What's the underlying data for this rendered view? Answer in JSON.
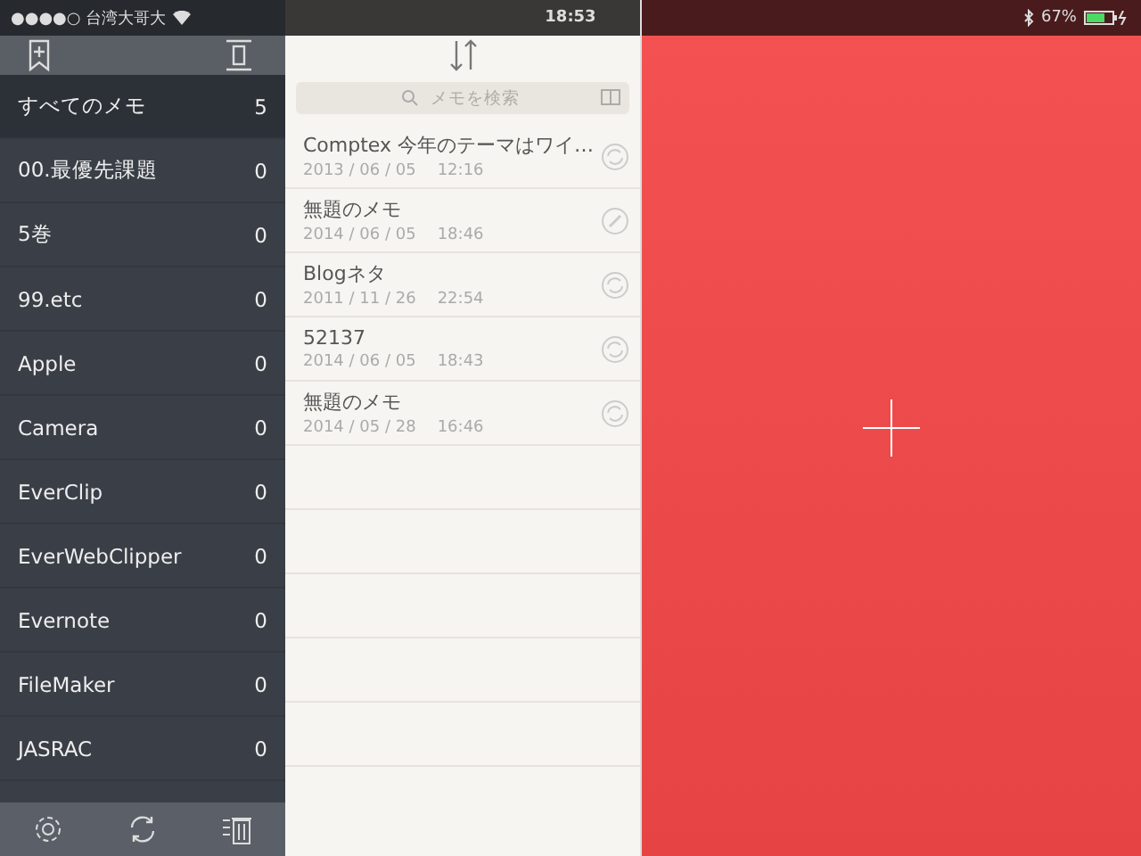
{
  "status_bar": {
    "carrier": "●●●●○ 台湾大哥大",
    "time": "18:53",
    "battery": "67%"
  },
  "sidebar": {
    "items": [
      {
        "label": "すべてのメモ",
        "count": "5",
        "selected": true
      },
      {
        "label": "00.最優先課題",
        "count": "0",
        "selected": false
      },
      {
        "label": "5巻",
        "count": "0",
        "selected": false
      },
      {
        "label": "99.etc",
        "count": "0",
        "selected": false
      },
      {
        "label": "Apple",
        "count": "0",
        "selected": false
      },
      {
        "label": "Camera",
        "count": "0",
        "selected": false
      },
      {
        "label": "EverClip",
        "count": "0",
        "selected": false
      },
      {
        "label": "EverWebClipper",
        "count": "0",
        "selected": false
      },
      {
        "label": "Evernote",
        "count": "0",
        "selected": false
      },
      {
        "label": "FileMaker",
        "count": "0",
        "selected": false
      },
      {
        "label": "JASRAC",
        "count": "0",
        "selected": false
      }
    ]
  },
  "search": {
    "placeholder": "メモを検索"
  },
  "notes": [
    {
      "title": "Comptex 今年のテーマはワイ…",
      "date": "2013 / 06 / 05",
      "time": "12:16",
      "kind": "sync"
    },
    {
      "title": "無題のメモ",
      "date": "2014 / 06 / 05",
      "time": "18:46",
      "kind": "edit"
    },
    {
      "title": "Blogネタ",
      "date": "2011 / 11 / 26",
      "time": "22:54",
      "kind": "sync"
    },
    {
      "title": "52137",
      "date": "2014 / 06 / 05",
      "time": "18:43",
      "kind": "sync"
    },
    {
      "title": "無題のメモ",
      "date": "2014 / 05 / 28",
      "time": "16:46",
      "kind": "sync"
    }
  ]
}
